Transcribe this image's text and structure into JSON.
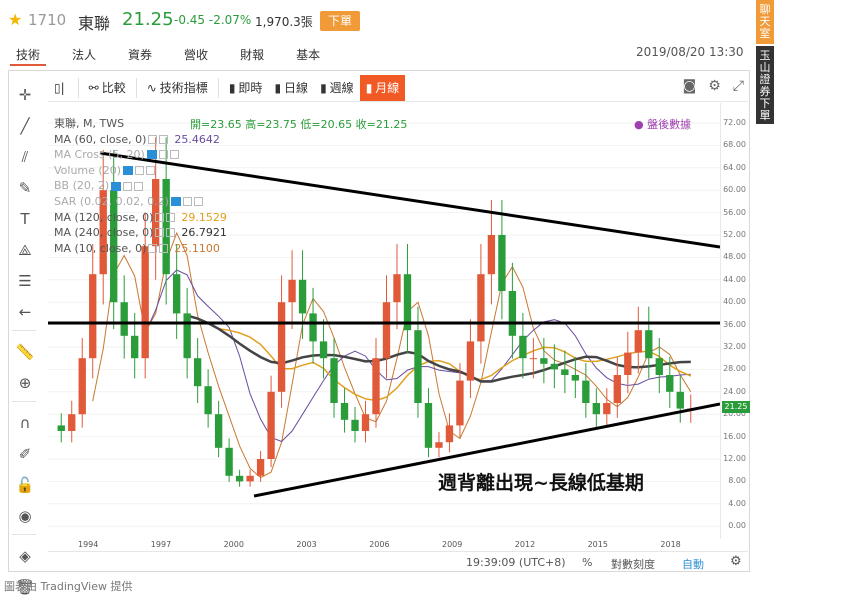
{
  "header": {
    "star_icon": "star-icon",
    "code": "1710",
    "name": "東聯",
    "price": "21.25",
    "change": "-0.45 -2.07%",
    "volume": "1,970.3張",
    "order_button": "下單",
    "datetime": "2019/08/20 13:30"
  },
  "tabs": [
    {
      "label": "技術",
      "active": true
    },
    {
      "label": "法人",
      "active": false
    },
    {
      "label": "資券",
      "active": false
    },
    {
      "label": "營收",
      "active": false
    },
    {
      "label": "財報",
      "active": false
    },
    {
      "label": "基本",
      "active": false
    }
  ],
  "side_buttons": {
    "chat": "聊天室",
    "trade": "玉山證券下單"
  },
  "toolbar": {
    "compare": "比較",
    "indicators": "技術指標",
    "intraday": "即時",
    "daily": "日線",
    "weekly": "週線",
    "monthly": "月線"
  },
  "legend": {
    "symbol": "東聯, M, TWS",
    "ohlc": "開=23.65 高=23.75 低=20.65 收=21.25",
    "after_hours": "盤後數據",
    "rows": [
      {
        "label": "MA (60, close, 0)",
        "value": "25.4642",
        "color": "#6a4ca0"
      },
      {
        "label": "MA Cross (5, 20)",
        "value": "",
        "color": "#9aa"
      },
      {
        "label": "Volume (20)",
        "value": "",
        "color": "#9aa"
      },
      {
        "label": "BB (20, 2)",
        "value": "",
        "color": "#9aa"
      },
      {
        "label": "SAR (0.02, 0.02, 0.2)",
        "value": "",
        "color": "#9aa"
      },
      {
        "label": "MA (120, close, 0)",
        "value": "29.1529",
        "color": "#e0a020"
      },
      {
        "label": "MA (240, close, 0)",
        "value": "26.7921",
        "color": "#333333"
      },
      {
        "label": "MA (10, close, 0)",
        "value": "25.1100",
        "color": "#c87830"
      }
    ]
  },
  "price_axis": [
    "72.00",
    "68.00",
    "64.00",
    "60.00",
    "56.00",
    "52.00",
    "48.00",
    "44.00",
    "40.00",
    "36.00",
    "32.00",
    "28.00",
    "24.00",
    "20.00",
    "16.00",
    "12.00",
    "8.00",
    "4.00",
    "0.00"
  ],
  "last_price_tag": "21.25",
  "time_axis": [
    "1994",
    "1997",
    "2000",
    "2003",
    "2006",
    "2009",
    "2012",
    "2015",
    "2018"
  ],
  "status_bar": {
    "time": "19:39:09 (UTC+8)",
    "percent": "%",
    "log": "對數刻度",
    "auto": "自動"
  },
  "annotation": "週背離出現~長線低基期",
  "footer_note": "圖表由 TradingView 提供",
  "colors": {
    "up": "#e05a3a",
    "down": "#2a9d3a",
    "accent": "#f15a24"
  }
}
